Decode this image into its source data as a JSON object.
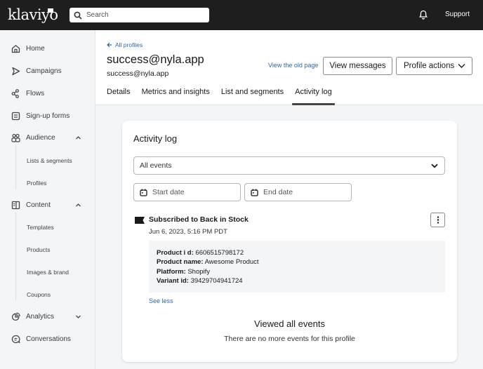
{
  "topbar": {
    "logo": "klaviyo",
    "search_placeholder": "Search",
    "support_label": "Support"
  },
  "sidebar": {
    "items": [
      {
        "label": "Home",
        "icon": "home-icon"
      },
      {
        "label": "Campaigns",
        "icon": "send-icon"
      },
      {
        "label": "Flows",
        "icon": "flows-icon"
      },
      {
        "label": "Sign-up forms",
        "icon": "form-icon"
      },
      {
        "label": "Audience",
        "icon": "audience-icon",
        "expanded": true,
        "children": [
          "Lists & segments",
          "Profiles"
        ]
      },
      {
        "label": "Content",
        "icon": "content-icon",
        "expanded": true,
        "children": [
          "Templates",
          "Products",
          "Images & brand",
          "Coupons"
        ]
      },
      {
        "label": "Analytics",
        "icon": "analytics-icon",
        "expanded": false
      },
      {
        "label": "Conversations",
        "icon": "conversations-icon"
      }
    ]
  },
  "header": {
    "back_label": "All profiles",
    "title": "success@nyla.app",
    "subtitle": "success@nyla.app",
    "old_page_label": "View the old page",
    "view_messages_label": "View messages",
    "profile_actions_label": "Profile actions",
    "tabs": [
      {
        "label": "Details",
        "active": false
      },
      {
        "label": "Metrics and insights",
        "active": false
      },
      {
        "label": "List and segments",
        "active": false
      },
      {
        "label": "Activity log",
        "active": true
      }
    ]
  },
  "activity": {
    "title": "Activity log",
    "filter_value": "All events",
    "start_date_placeholder": "Start date",
    "end_date_placeholder": "End date",
    "event": {
      "title": "Subscribed to Back in Stock",
      "timestamp": "Jun 6, 2023, 5:16 PM PDT",
      "details": [
        {
          "key": "Product i d:",
          "value": "6606515798172"
        },
        {
          "key": "Product name:",
          "value": "Awesome Product"
        },
        {
          "key": "Platform:",
          "value": "Shopify"
        },
        {
          "key": "Variant id:",
          "value": "39429704941724"
        }
      ],
      "toggle_label": "See less"
    },
    "end_title": "Viewed all events",
    "end_subtitle": "There are no more events for this profile"
  },
  "colors": {
    "topbar_bg": "#1e1e1e",
    "link": "#2c68ad",
    "page_bg": "#f4f5f7"
  }
}
